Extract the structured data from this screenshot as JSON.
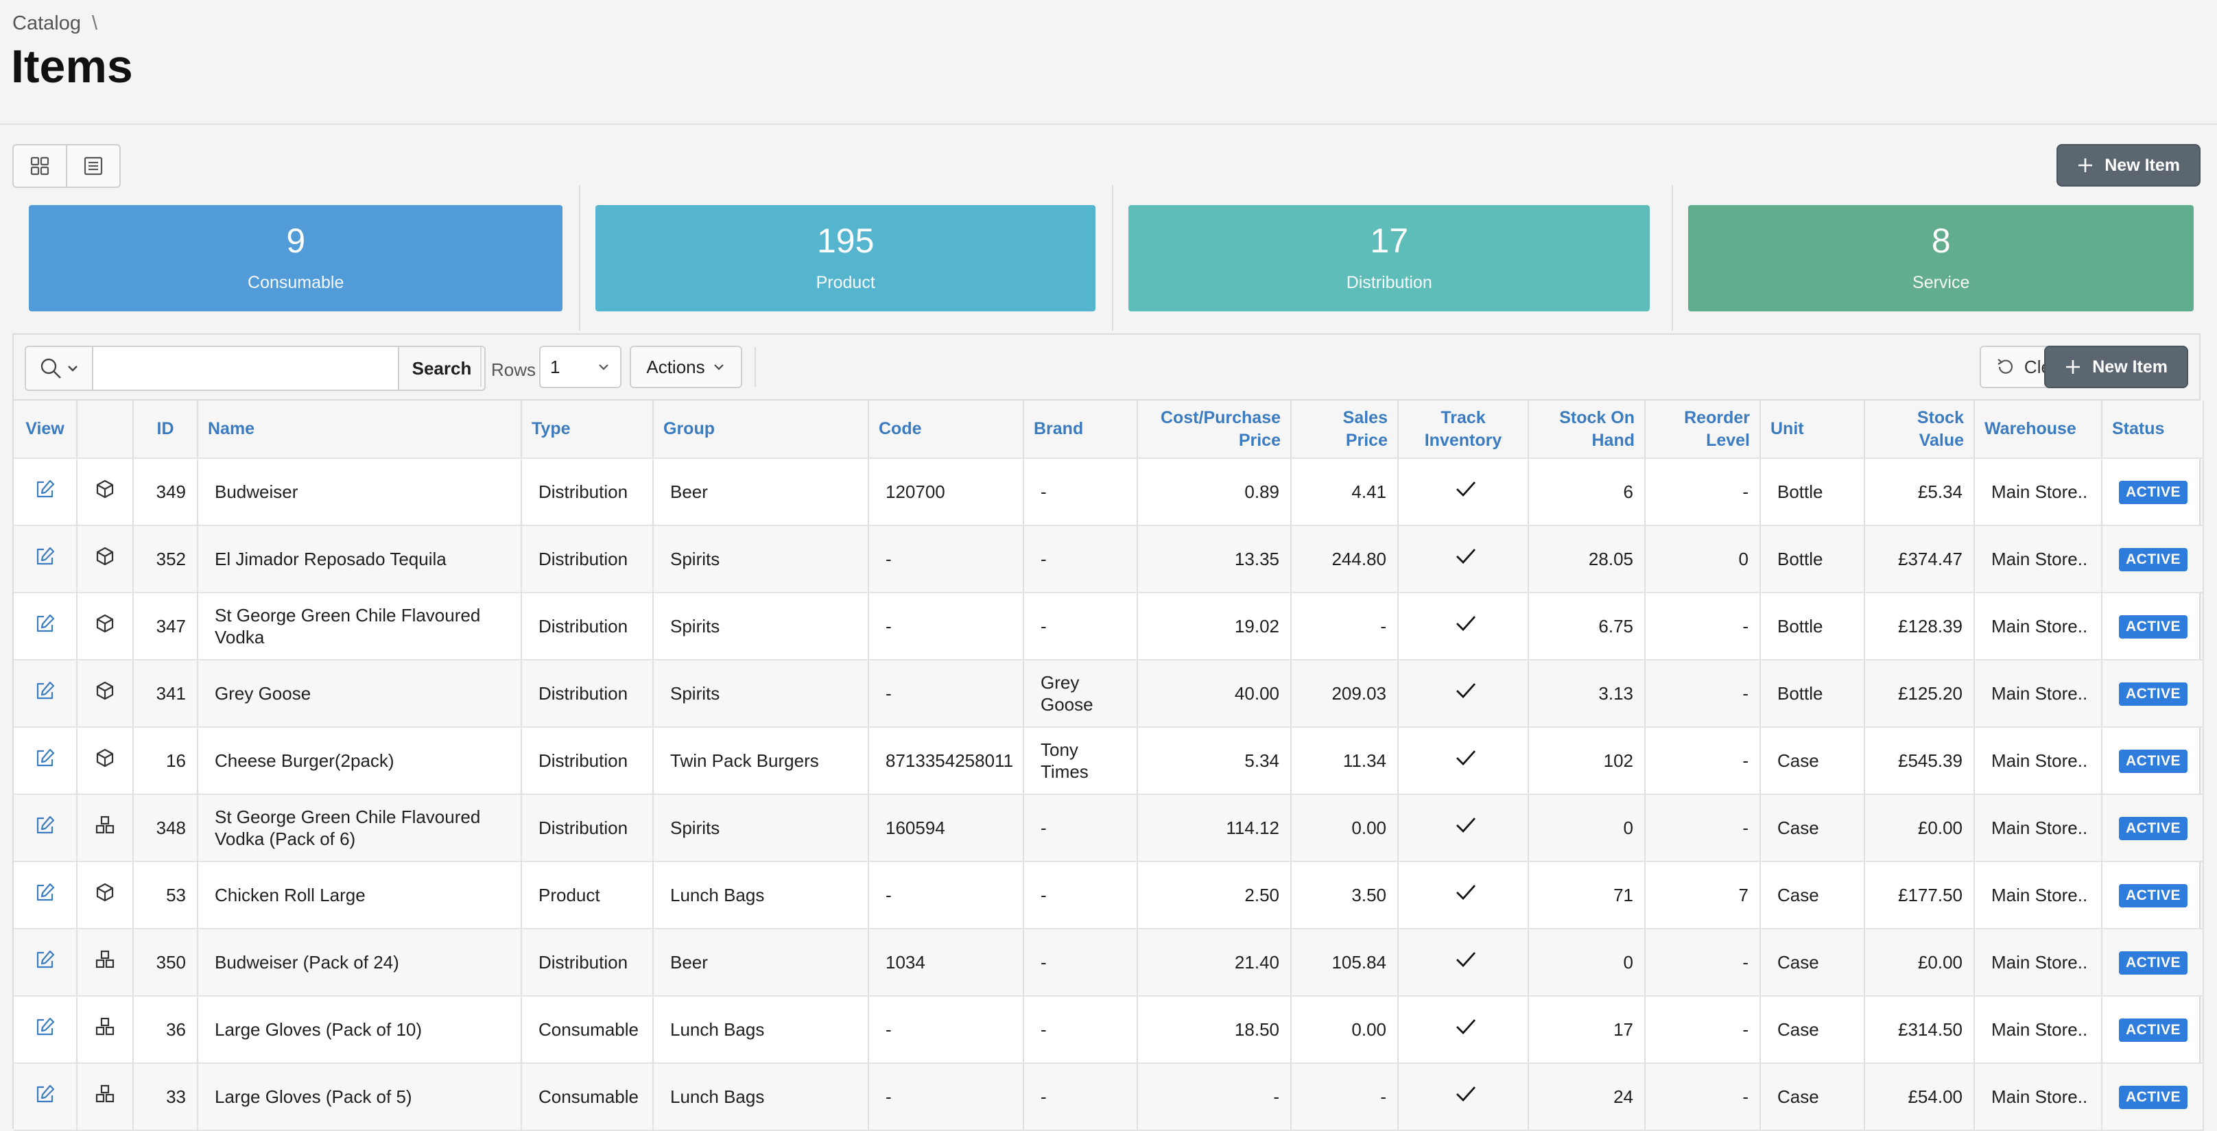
{
  "breadcrumb": {
    "parent": "Catalog",
    "separator": "\\"
  },
  "page": {
    "title": "Items"
  },
  "toolbar": {
    "new_item_label": "New Item"
  },
  "stats": [
    {
      "value": "9",
      "label": "Consumable",
      "color": "#519bd8"
    },
    {
      "value": "195",
      "label": "Product",
      "color": "#56b5ce"
    },
    {
      "value": "17",
      "label": "Distribution",
      "color": "#5fbdb9"
    },
    {
      "value": "8",
      "label": "Service",
      "color": "#62ad8d"
    }
  ],
  "search": {
    "placeholder": "",
    "button_label": "Search"
  },
  "rows": {
    "label": "Rows",
    "value": "1"
  },
  "actions": {
    "label": "Actions"
  },
  "clear": {
    "label": "Clear"
  },
  "new_item": {
    "label": "New Item"
  },
  "columns": {
    "view": "View",
    "id": "ID",
    "name": "Name",
    "type": "Type",
    "group": "Group",
    "code": "Code",
    "brand": "Brand",
    "cost_1": "Cost/Purchase",
    "cost_2": "Price",
    "sales_1": "Sales",
    "sales_2": "Price",
    "track_1": "Track",
    "track_2": "Inventory",
    "stock_1": "Stock On",
    "stock_2": "Hand",
    "reorder_1": "Reorder",
    "reorder_2": "Level",
    "unit": "Unit",
    "value_1": "Stock",
    "value_2": "Value",
    "warehouse": "Warehouse",
    "status": "Status"
  },
  "items": [
    {
      "icon": "box",
      "id": "349",
      "name": "Budweiser",
      "type": "Distribution",
      "group": "Beer",
      "code": "120700",
      "brand": "-",
      "cost": "0.89",
      "sales": "4.41",
      "stock": "6",
      "reorder": "-",
      "unit": "Bottle",
      "value": "£5.34",
      "warehouse": "Main Store..",
      "status": "ACTIVE"
    },
    {
      "icon": "box",
      "id": "352",
      "name": "El Jimador Reposado Tequila",
      "type": "Distribution",
      "group": "Spirits",
      "code": "-",
      "brand": "-",
      "cost": "13.35",
      "sales": "244.80",
      "stock": "28.05",
      "reorder": "0",
      "unit": "Bottle",
      "value": "£374.47",
      "warehouse": "Main Store..",
      "status": "ACTIVE"
    },
    {
      "icon": "box",
      "id": "347",
      "name": "St George Green Chile Flavoured Vodka",
      "type": "Distribution",
      "group": "Spirits",
      "code": "-",
      "brand": "-",
      "cost": "19.02",
      "sales": "-",
      "stock": "6.75",
      "reorder": "-",
      "unit": "Bottle",
      "value": "£128.39",
      "warehouse": "Main Store..",
      "status": "ACTIVE"
    },
    {
      "icon": "box",
      "id": "341",
      "name": "Grey Goose",
      "type": "Distribution",
      "group": "Spirits",
      "code": "-",
      "brand": "Grey Goose",
      "cost": "40.00",
      "sales": "209.03",
      "stock": "3.13",
      "reorder": "-",
      "unit": "Bottle",
      "value": "£125.20",
      "warehouse": "Main Store..",
      "status": "ACTIVE"
    },
    {
      "icon": "box",
      "id": "16",
      "name": "Cheese Burger(2pack)",
      "type": "Distribution",
      "group": "Twin Pack Burgers",
      "code": "8713354258011",
      "brand": "Tony Times",
      "cost": "5.34",
      "sales": "11.34",
      "stock": "102",
      "reorder": "-",
      "unit": "Case",
      "value": "£545.39",
      "warehouse": "Main Store..",
      "status": "ACTIVE"
    },
    {
      "icon": "boxes",
      "id": "348",
      "name": "St George Green Chile Flavoured Vodka (Pack of 6)",
      "type": "Distribution",
      "group": "Spirits",
      "code": "160594",
      "brand": "-",
      "cost": "114.12",
      "sales": "0.00",
      "stock": "0",
      "reorder": "-",
      "unit": "Case",
      "value": "£0.00",
      "warehouse": "Main Store..",
      "status": "ACTIVE"
    },
    {
      "icon": "box",
      "id": "53",
      "name": "Chicken Roll Large",
      "type": "Product",
      "group": "Lunch Bags",
      "code": "-",
      "brand": "-",
      "cost": "2.50",
      "sales": "3.50",
      "stock": "71",
      "reorder": "7",
      "unit": "Case",
      "value": "£177.50",
      "warehouse": "Main Store..",
      "status": "ACTIVE"
    },
    {
      "icon": "boxes",
      "id": "350",
      "name": "Budweiser (Pack of 24)",
      "type": "Distribution",
      "group": "Beer",
      "code": "1034",
      "brand": "-",
      "cost": "21.40",
      "sales": "105.84",
      "stock": "0",
      "reorder": "-",
      "unit": "Case",
      "value": "£0.00",
      "warehouse": "Main Store..",
      "status": "ACTIVE"
    },
    {
      "icon": "boxes",
      "id": "36",
      "name": "Large Gloves (Pack of 10)",
      "type": "Consumable",
      "group": "Lunch Bags",
      "code": "-",
      "brand": "-",
      "cost": "18.50",
      "sales": "0.00",
      "stock": "17",
      "reorder": "-",
      "unit": "Case",
      "value": "£314.50",
      "warehouse": "Main Store..",
      "status": "ACTIVE"
    },
    {
      "icon": "boxes",
      "id": "33",
      "name": "Large Gloves (Pack of 5)",
      "type": "Consumable",
      "group": "Lunch Bags",
      "code": "-",
      "brand": "-",
      "cost": "-",
      "sales": "-",
      "stock": "24",
      "reorder": "-",
      "unit": "Case",
      "value": "£54.00",
      "warehouse": "Main Store..",
      "status": "ACTIVE"
    }
  ]
}
